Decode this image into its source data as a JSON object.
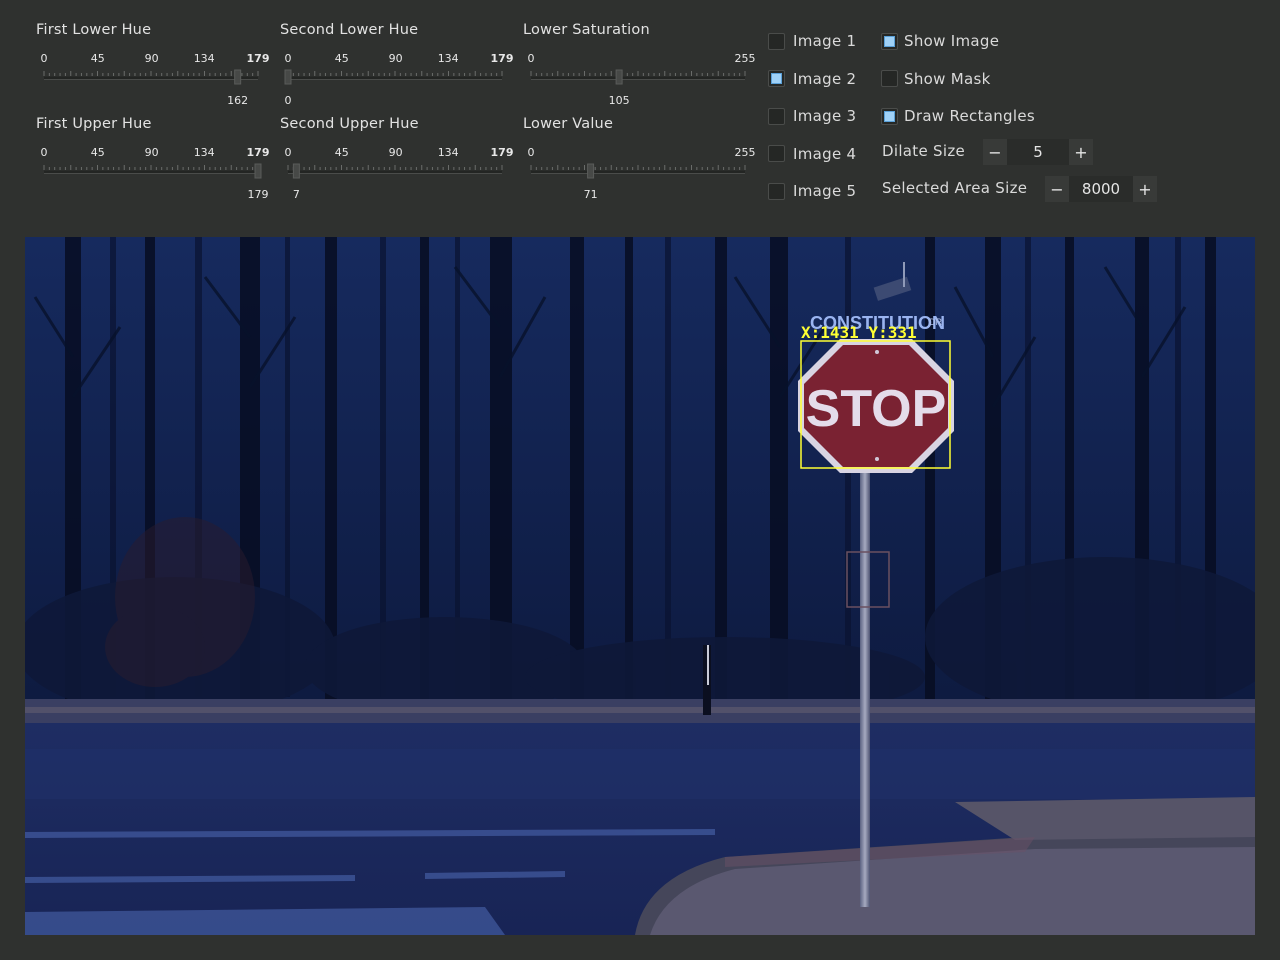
{
  "sliders": [
    {
      "id": "first-lower-hue",
      "title": "First Lower Hue",
      "ticks": [
        "0",
        "45",
        "90",
        "134",
        "179"
      ],
      "max": 179,
      "value": 162,
      "value_label": "162"
    },
    {
      "id": "second-lower-hue",
      "title": "Second Lower Hue",
      "ticks": [
        "0",
        "45",
        "90",
        "134",
        "179"
      ],
      "max": 179,
      "value": 0,
      "value_label": "0"
    },
    {
      "id": "lower-saturation",
      "title": "Lower Saturation",
      "ticks": [
        "0",
        "255"
      ],
      "max": 255,
      "value": 105,
      "value_label": "105"
    },
    {
      "id": "first-upper-hue",
      "title": "First Upper Hue",
      "ticks": [
        "0",
        "45",
        "90",
        "134",
        "179"
      ],
      "max": 179,
      "value": 179,
      "value_label": "179"
    },
    {
      "id": "second-upper-hue",
      "title": "Second Upper Hue",
      "ticks": [
        "0",
        "45",
        "90",
        "134",
        "179"
      ],
      "max": 179,
      "value": 7,
      "value_label": "7"
    },
    {
      "id": "lower-value",
      "title": "Lower Value",
      "ticks": [
        "0",
        "255"
      ],
      "max": 255,
      "value": 71,
      "value_label": "71"
    }
  ],
  "images": [
    {
      "label": "Image 1",
      "checked": false
    },
    {
      "label": "Image 2",
      "checked": true
    },
    {
      "label": "Image 3",
      "checked": false
    },
    {
      "label": "Image 4",
      "checked": false
    },
    {
      "label": "Image 5",
      "checked": false
    }
  ],
  "options": [
    {
      "label": "Show Image",
      "checked": true
    },
    {
      "label": "Show Mask",
      "checked": false
    },
    {
      "label": "Draw Rectangles",
      "checked": true
    }
  ],
  "dilate": {
    "label": "Dilate Size",
    "value": "5",
    "minus": "−",
    "plus": "+"
  },
  "area": {
    "label": "Selected Area Size",
    "value": "8000",
    "minus": "−",
    "plus": "+"
  },
  "scene": {
    "street_sign_text": "CONSTITUTION",
    "street_sign_suffix": "DR",
    "stop_text": "STOP",
    "detection_label": "X:1431  Y:331"
  },
  "colors": {
    "accent_check": "#9fd1f7",
    "detection_box": "#ffff33",
    "stop_red": "#7a2232"
  }
}
